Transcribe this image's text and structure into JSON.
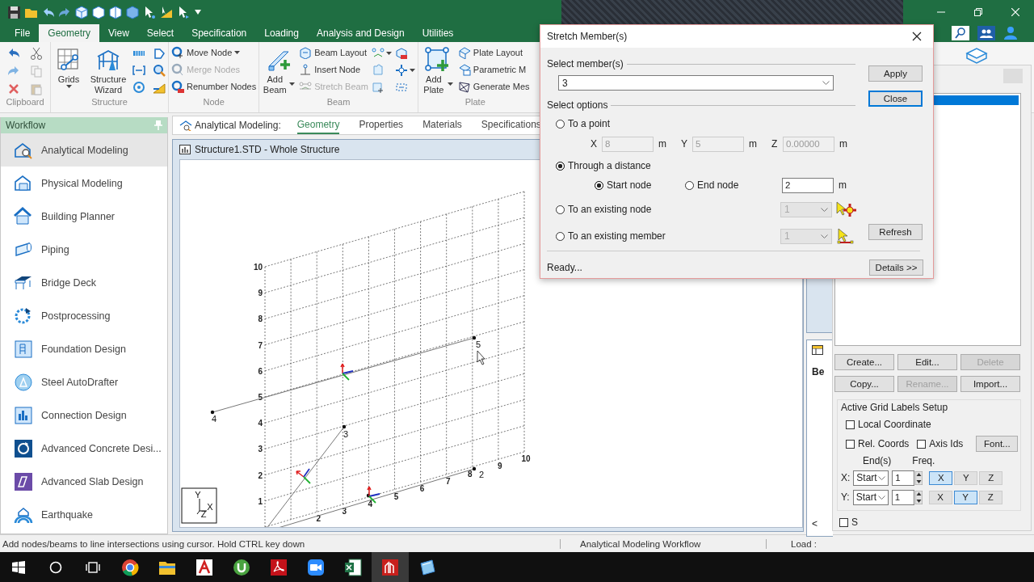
{
  "ribbon": {
    "tabs": [
      {
        "label": "File",
        "selected": false
      },
      {
        "label": "Geometry",
        "selected": true
      },
      {
        "label": "View",
        "selected": false
      },
      {
        "label": "Select",
        "selected": false
      },
      {
        "label": "Specification",
        "selected": false
      },
      {
        "label": "Loading",
        "selected": false
      },
      {
        "label": "Analysis and Design",
        "selected": false
      },
      {
        "label": "Utilities",
        "selected": false
      }
    ],
    "groups": [
      {
        "kind": "clipboard",
        "label": "Clipboard"
      },
      {
        "kind": "structure",
        "label": "Structure",
        "buttons": [
          {
            "label": "Grids",
            "dropdown": true
          },
          {
            "label": "Structure Wizard",
            "dropdown": false
          }
        ]
      },
      {
        "kind": "node",
        "label": "Node",
        "items": [
          {
            "label": "Move Node",
            "dropdown": true,
            "disabled": false
          },
          {
            "label": "Merge Nodes",
            "dropdown": false,
            "disabled": true
          },
          {
            "label": "Renumber Nodes",
            "dropdown": false,
            "disabled": false
          }
        ]
      },
      {
        "kind": "beam",
        "label": "Beam",
        "buttons": [
          {
            "label": "Add Beam",
            "dropdown": true
          }
        ],
        "items": [
          {
            "label": "Beam Layout",
            "dropdown": false,
            "disabled": false
          },
          {
            "label": "Insert Node",
            "dropdown": false,
            "disabled": false
          },
          {
            "label": "Stretch Beam",
            "dropdown": false,
            "disabled": true
          }
        ]
      },
      {
        "kind": "plate",
        "label": "Plate",
        "buttons": [
          {
            "label": "Add Plate",
            "dropdown": true
          }
        ],
        "items": [
          {
            "label": "Plate Layout",
            "dropdown": false,
            "disabled": false
          },
          {
            "label": "Parametric M",
            "dropdown": false,
            "disabled": false
          },
          {
            "label": "Generate Mes",
            "dropdown": false,
            "disabled": false
          }
        ]
      }
    ]
  },
  "workflow": {
    "title": "Workflow",
    "items": [
      {
        "label": "Analytical Modeling",
        "selected": true
      },
      {
        "label": "Physical Modeling",
        "selected": false
      },
      {
        "label": "Building Planner",
        "selected": false
      },
      {
        "label": "Piping",
        "selected": false
      },
      {
        "label": "Bridge Deck",
        "selected": false
      },
      {
        "label": "Postprocessing",
        "selected": false
      },
      {
        "label": "Foundation Design",
        "selected": false
      },
      {
        "label": "Steel AutoDrafter",
        "selected": false
      },
      {
        "label": "Connection Design",
        "selected": false
      },
      {
        "label": "Advanced Concrete Desi...",
        "selected": false
      },
      {
        "label": "Advanced Slab Design",
        "selected": false
      },
      {
        "label": "Earthquake",
        "selected": false
      }
    ]
  },
  "page_tabs": {
    "title": "Analytical Modeling:",
    "tabs": [
      {
        "label": "Geometry",
        "selected": true
      },
      {
        "label": "Properties",
        "selected": false
      },
      {
        "label": "Materials",
        "selected": false
      },
      {
        "label": "Specifications",
        "selected": false
      }
    ]
  },
  "structure_window": {
    "title": "Structure1.STD - Whole Structure",
    "y_labels": [
      "10",
      "9",
      "8",
      "7",
      "6",
      "5",
      "4",
      "3",
      "2",
      "1"
    ],
    "x_labels": [
      "2",
      "3",
      "4",
      "5",
      "6",
      "7",
      "8",
      "9",
      "10"
    ],
    "nodes": [
      {
        "label": "4"
      },
      {
        "label": "5"
      },
      {
        "label": "3"
      },
      {
        "label": "2"
      }
    ],
    "axes": [
      "Y",
      "X",
      "Z"
    ]
  },
  "side_window": {
    "header": "Be",
    "scroll": "<"
  },
  "dialog": {
    "title": "Stretch Member(s)",
    "member_group": "Select member(s)",
    "member_value": "3",
    "options_group": "Select options",
    "options": [
      {
        "kind": "point",
        "label": "To a point",
        "selected": false,
        "disabled": true,
        "coords": [
          {
            "axis": "X",
            "value": "8",
            "unit": "m"
          },
          {
            "axis": "Y",
            "value": "5",
            "unit": "m"
          },
          {
            "axis": "Z",
            "value": "0.00000",
            "unit": "m"
          }
        ]
      },
      {
        "kind": "distance",
        "label": "Through a distance",
        "selected": true,
        "ends": [
          {
            "label": "Start node",
            "selected": true
          },
          {
            "label": "End node",
            "selected": false
          }
        ],
        "value": "2",
        "unit": "m"
      },
      {
        "kind": "node",
        "label": "To an existing node",
        "selected": false,
        "disabled": true,
        "value": "1"
      },
      {
        "kind": "member",
        "label": "To an existing member",
        "selected": false,
        "disabled": true,
        "value": "1"
      }
    ],
    "buttons": [
      {
        "label": "Apply",
        "focused": false
      },
      {
        "label": "Close",
        "focused": true
      }
    ],
    "refresh": "Refresh",
    "status": "Ready...",
    "details": "Details >>"
  },
  "right_panel": {
    "list_rows": [
      {
        "selected": true
      }
    ],
    "buttons": [
      {
        "label": "Create...",
        "disabled": false
      },
      {
        "label": "Edit...",
        "disabled": false
      },
      {
        "label": "Delete",
        "disabled": true
      },
      {
        "label": "Copy...",
        "disabled": false
      },
      {
        "label": "Rename...",
        "disabled": true
      },
      {
        "label": "Import...",
        "disabled": false
      }
    ],
    "grid_labels": {
      "title": "Active Grid Labels Setup",
      "checkboxes": [
        {
          "label": "Local Coordinate",
          "checked": false
        },
        {
          "label": "Rel. Coords",
          "checked": false
        },
        {
          "label": "Axis Ids",
          "checked": false
        }
      ],
      "font_button": "Font...",
      "headers": [
        "End(s)",
        "Freq."
      ],
      "rows": [
        {
          "label": "X:",
          "end": "Start",
          "freq": "1",
          "axes": [
            {
              "label": "X",
              "selected": true
            },
            {
              "label": "Y",
              "selected": false
            },
            {
              "label": "Z",
              "selected": false
            }
          ]
        },
        {
          "label": "Y:",
          "end": "Start",
          "freq": "1",
          "axes": [
            {
              "label": "X",
              "selected": false
            },
            {
              "label": "Y",
              "selected": true
            },
            {
              "label": "Z",
              "selected": false
            }
          ]
        }
      ]
    },
    "bottom_checkbox": {
      "label": "S",
      "checked": false
    }
  },
  "status_bar": {
    "message": "Add nodes/beams to line intersections using cursor. Hold CTRL key down",
    "workflow": "Analytical Modeling Workflow",
    "load": "Load :"
  },
  "taskbar": {
    "apps": [
      {
        "selected": false
      },
      {
        "selected": false
      },
      {
        "selected": false
      },
      {
        "selected": false
      },
      {
        "selected": false
      },
      {
        "selected": false
      },
      {
        "selected": false
      },
      {
        "selected": true
      },
      {
        "selected": false
      }
    ]
  }
}
